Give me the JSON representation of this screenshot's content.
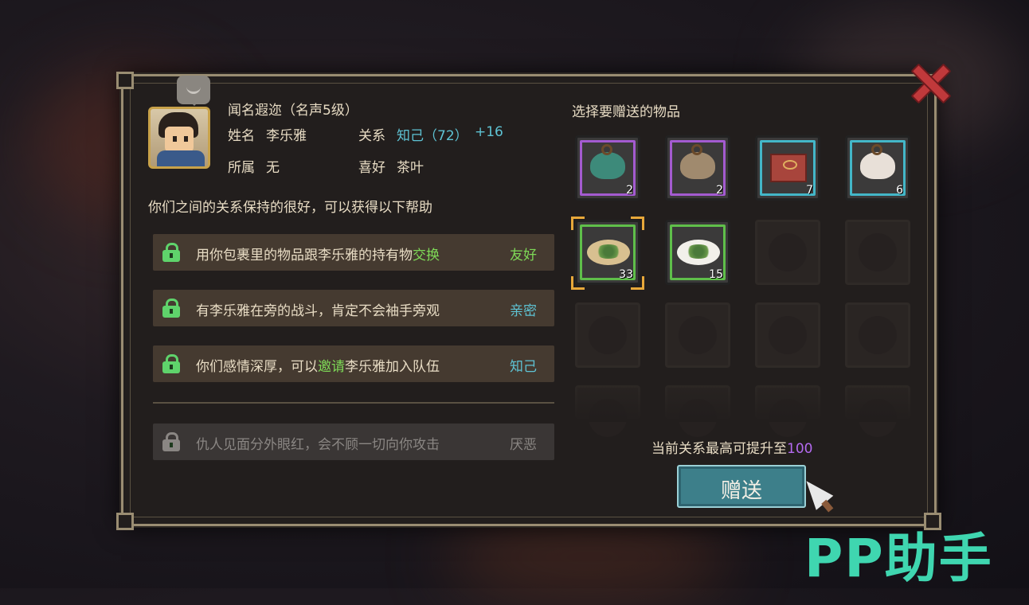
{
  "character": {
    "reputation": "闻名遐迩（名声5级）",
    "name_label": "姓名",
    "name": "李乐雅",
    "relation_label": "关系",
    "relation_value": "知己（72）",
    "relation_bonus": "+16",
    "faction_label": "所属",
    "faction": "无",
    "likes_label": "喜好",
    "likes": "茶叶"
  },
  "help_intro": "你们之间的关系保持的很好，可以获得以下帮助",
  "benefits": [
    {
      "text_a": "用你包裹里的物品跟李乐雅的持有物",
      "text_hl": "交换",
      "text_b": "",
      "tag": "友好",
      "tag_color": "#7ed957",
      "unlocked": true
    },
    {
      "text_a": "有李乐雅在旁的战斗，肯定不会袖手旁观",
      "text_hl": "",
      "text_b": "",
      "tag": "亲密",
      "tag_color": "#5ec3d4",
      "unlocked": true
    },
    {
      "text_a": "你们感情深厚，可以",
      "text_hl": "邀请",
      "text_b": "李乐雅加入队伍",
      "tag": "知己",
      "tag_color": "#5ec3d4",
      "unlocked": true
    },
    {
      "text_a": "仇人见面分外眼红，会不顾一切向你攻击",
      "text_hl": "",
      "text_b": "",
      "tag": "厌恶",
      "tag_color": "#8a8683",
      "unlocked": false
    }
  ],
  "gift": {
    "title": "选择要赠送的物品",
    "items": [
      {
        "icon": "pouch-teal-icon",
        "count": "2",
        "frame": "#a35bd0"
      },
      {
        "icon": "pouch-brown-icon",
        "count": "2",
        "frame": "#a35bd0"
      },
      {
        "icon": "gift-box-icon",
        "count": "7",
        "frame": "#43b7c8"
      },
      {
        "icon": "bundle-icon",
        "count": "6",
        "frame": "#43b7c8"
      },
      {
        "icon": "tea-plate-icon",
        "count": "33",
        "frame": "#5fbf4a"
      },
      {
        "icon": "tea-dish-icon",
        "count": "15",
        "frame": "#5fbf4a"
      }
    ],
    "max_text": "当前关系最高可提升至",
    "max_value": "100",
    "button": "赠送"
  },
  "watermark": "PP助手",
  "colors": {
    "panel_border": "#9a8d72",
    "accent_teal": "#5ec3d4",
    "accent_green": "#7ed957",
    "accent_purple": "#b46af0"
  }
}
